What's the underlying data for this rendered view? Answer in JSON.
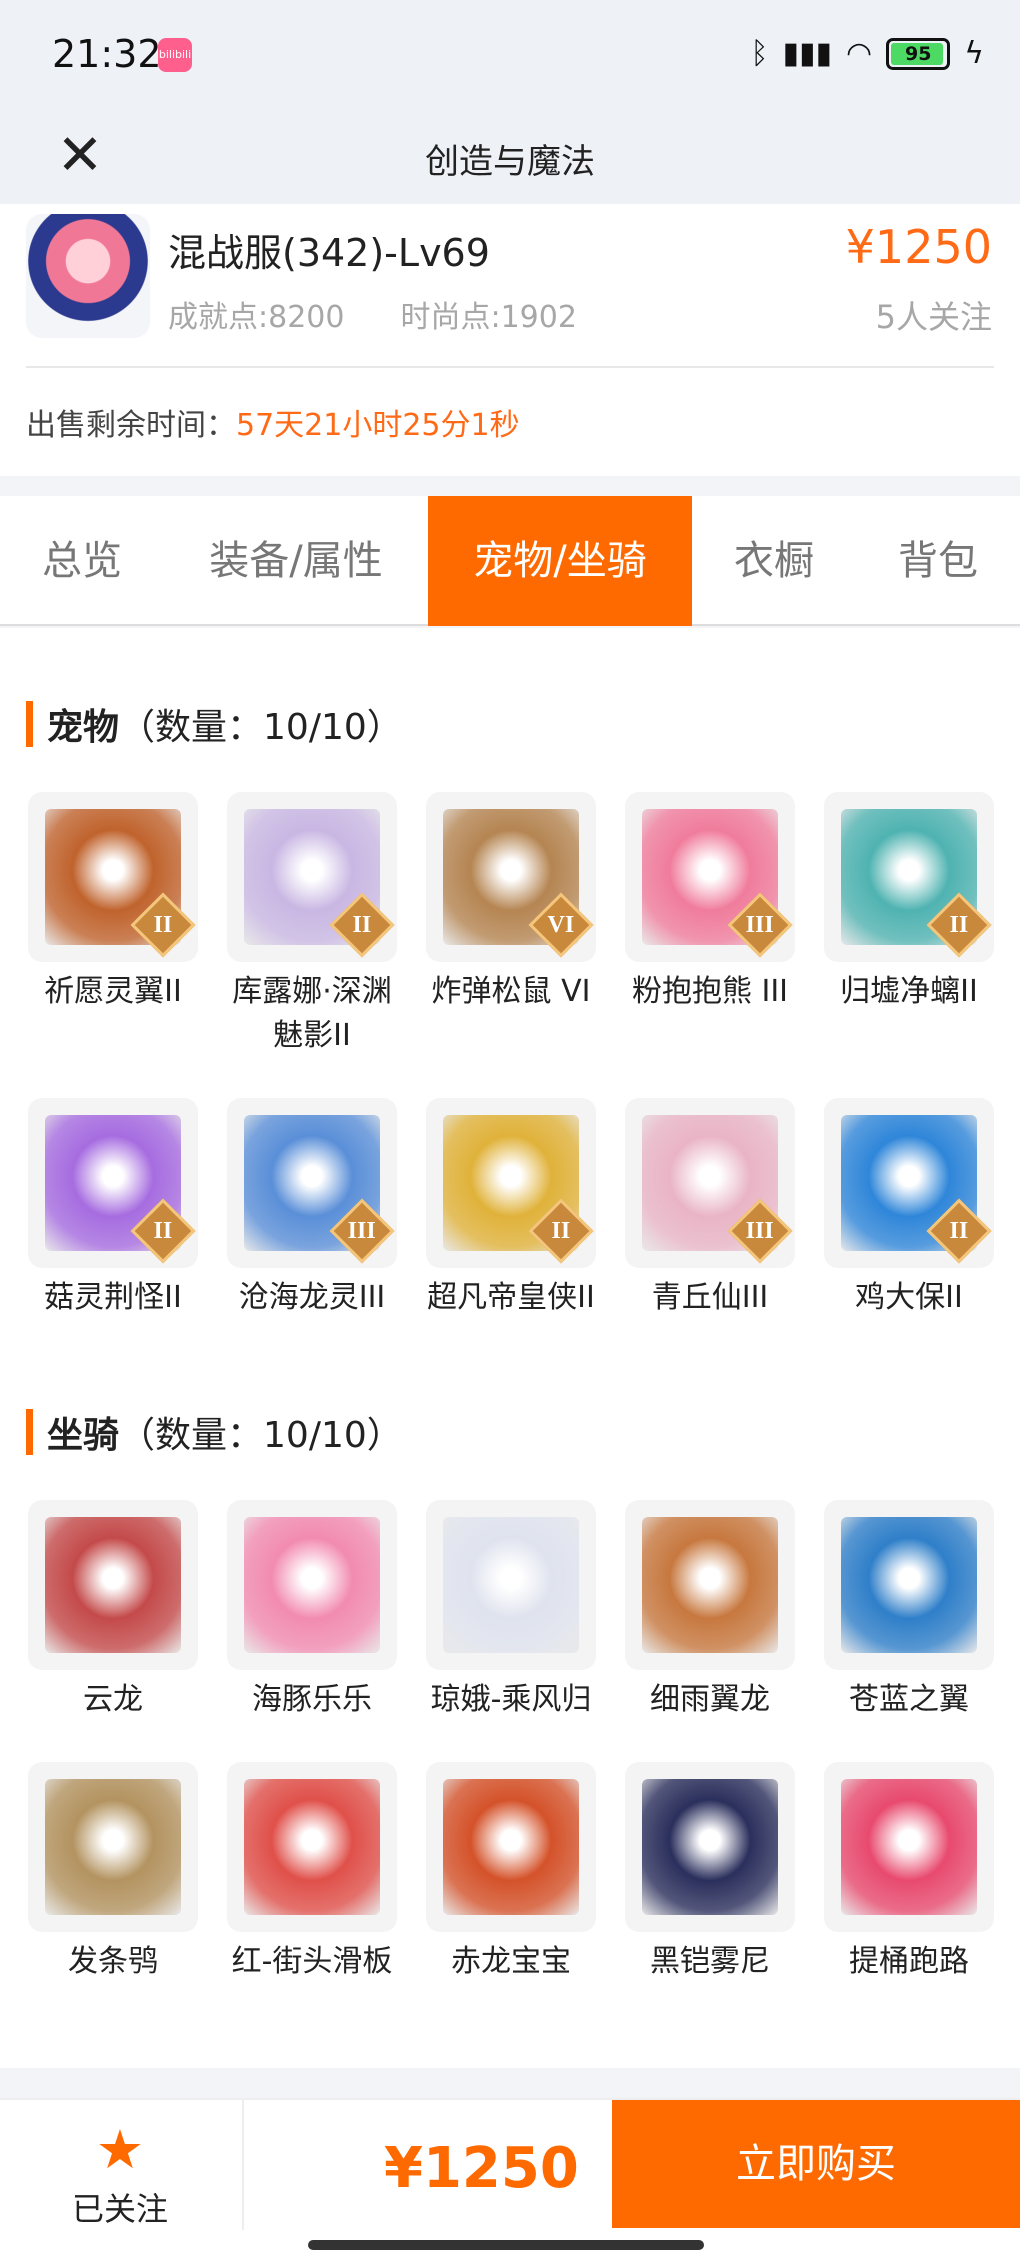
{
  "status_bar": {
    "time": "21:32",
    "app_icon_text": "bilibili",
    "battery": "95",
    "battery_level": 0.95,
    "icons": [
      "bluetooth-icon",
      "signal-hd-icon",
      "wifi-icon",
      "battery-icon",
      "charging-icon"
    ]
  },
  "nav": {
    "title": "创造与魔法",
    "close_icon": "close-icon"
  },
  "account": {
    "name": "混战服(342)-Lv69",
    "achievement": "成就点:8200",
    "fashion": "时尚点:1902",
    "price": "¥1250",
    "followers": "5人关注",
    "remain_label": "出售剩余时间：",
    "remain_value": "57天21小时25分1秒"
  },
  "tabs": [
    {
      "label": "总览",
      "active": false
    },
    {
      "label": "装备/属性",
      "active": false
    },
    {
      "label": "宠物/坐骑",
      "active": true
    },
    {
      "label": "衣橱",
      "active": false
    },
    {
      "label": "背包",
      "active": false
    }
  ],
  "pets": {
    "title": "宠物",
    "count": "（数量：10/10）",
    "items": [
      {
        "name": "祈愿灵翼II",
        "badge": "II",
        "color": "#c0632d"
      },
      {
        "name": "库露娜·深渊魅影II",
        "badge": "II",
        "color": "#c9b7e3"
      },
      {
        "name": "炸弹松鼠 VI",
        "badge": "VI",
        "color": "#b58552"
      },
      {
        "name": "粉抱抱熊 III",
        "badge": "III",
        "color": "#f07c9c"
      },
      {
        "name": "归墟净螭II",
        "badge": "II",
        "color": "#4fb3b1"
      },
      {
        "name": "菇灵荆怪II",
        "badge": "II",
        "color": "#a66ce0"
      },
      {
        "name": "沧海龙灵III",
        "badge": "III",
        "color": "#5a8fd8"
      },
      {
        "name": "超凡帝皇侠II",
        "badge": "II",
        "color": "#e0b23a"
      },
      {
        "name": "青丘仙III",
        "badge": "III",
        "color": "#e9b4c6"
      },
      {
        "name": "鸡大保II",
        "badge": "II",
        "color": "#2f86d9"
      }
    ]
  },
  "mounts": {
    "title": "坐骑",
    "count": "（数量：10/10）",
    "items": [
      {
        "name": "云龙",
        "color": "#c44a4a"
      },
      {
        "name": "海豚乐乐",
        "color": "#f28bb0"
      },
      {
        "name": "琼娥-乘风归",
        "color": "#dfe3ee"
      },
      {
        "name": "细雨翼龙",
        "color": "#c7783f"
      },
      {
        "name": "苍蓝之翼",
        "color": "#2f7fc9"
      },
      {
        "name": "发条鸮",
        "color": "#b39360"
      },
      {
        "name": "红-街头滑板",
        "color": "#e0504a"
      },
      {
        "name": "赤龙宝宝",
        "color": "#d4522a"
      },
      {
        "name": "黑铠雾尼",
        "color": "#2b2f5c"
      },
      {
        "name": "提桶跑路",
        "color": "#e84a6e"
      }
    ]
  },
  "bottom": {
    "follow_label": "已关注",
    "price": "¥1250",
    "buy_label": "立即购买"
  },
  "colors": {
    "accent": "#ff6a00",
    "price": "#ff6a17",
    "muted": "#a7a7a7"
  }
}
